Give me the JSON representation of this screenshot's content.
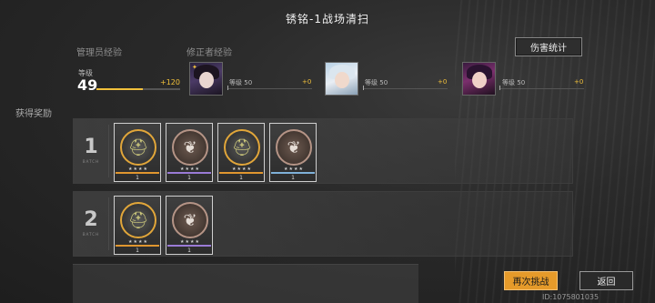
{
  "header": {
    "title": "锈铭-1战场清扫"
  },
  "manager": {
    "section_label": "管理员经验",
    "level_label": "等级",
    "level": "49",
    "gain": "+120",
    "progress": 0.55
  },
  "rectifier": {
    "section_label": "修正者经验",
    "members": [
      {
        "level_label": "等级",
        "level": "50",
        "gain": "+0",
        "badge": "✦"
      },
      {
        "level_label": "等级",
        "level": "50",
        "gain": "+0",
        "badge": ""
      },
      {
        "level_label": "等级",
        "level": "50",
        "gain": "+0",
        "badge": ""
      }
    ]
  },
  "rewards": {
    "section_label": "获得奖励",
    "batch_word": "BATCH",
    "batches": [
      {
        "number": "1",
        "items": [
          {
            "coin": "gold",
            "icon": "spartan-helmet-icon",
            "rarity": "orange",
            "stars": "★★★★",
            "qty": "1"
          },
          {
            "coin": "bronze",
            "icon": "winged-emblem-icon",
            "rarity": "purple",
            "stars": "★★★★",
            "qty": "1"
          },
          {
            "coin": "gold",
            "icon": "spartan-helmet-icon",
            "rarity": "orange",
            "stars": "★★★★",
            "qty": "1"
          },
          {
            "coin": "bronze",
            "icon": "winged-emblem-icon",
            "rarity": "blue",
            "stars": "★★★★",
            "qty": "1"
          }
        ]
      },
      {
        "number": "2",
        "items": [
          {
            "coin": "gold",
            "icon": "spartan-helmet-icon",
            "rarity": "orange",
            "stars": "★★★★",
            "qty": "1"
          },
          {
            "coin": "bronze",
            "icon": "winged-emblem-icon",
            "rarity": "purple",
            "stars": "★★★★",
            "qty": "1"
          }
        ]
      }
    ]
  },
  "buttons": {
    "stats": "伤害统计",
    "retry": "再次挑战",
    "back": "返回"
  },
  "footer": {
    "id_text": "ID:1075801035"
  },
  "colors": {
    "accent": "#e59a2a",
    "gain": "#f2c13b"
  }
}
